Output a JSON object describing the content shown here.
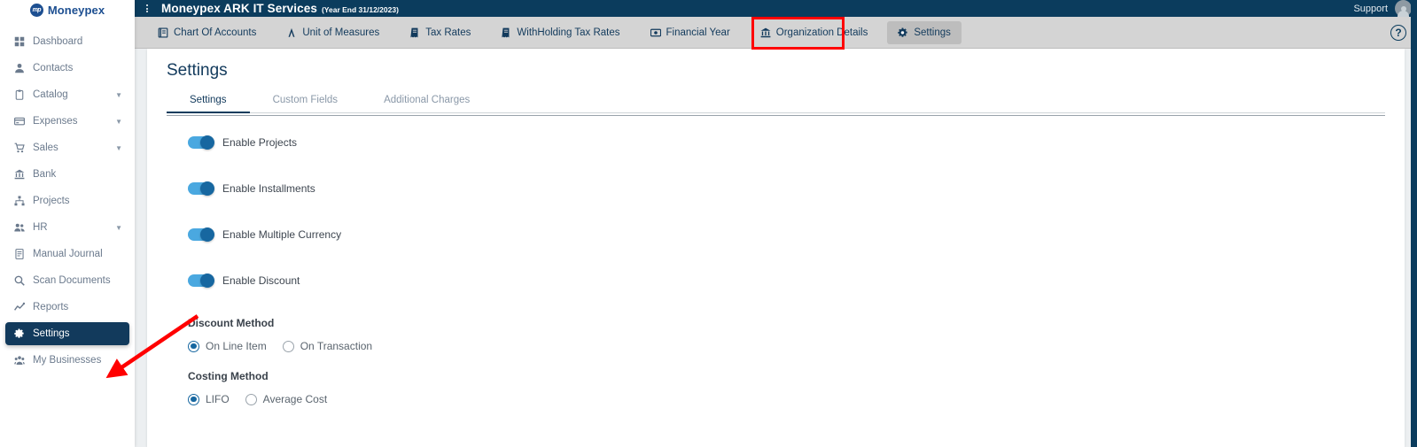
{
  "brand": {
    "name": "Moneypex",
    "logo_glyph": "mp",
    "accent_dark": "#0b3c5d",
    "accent_blue": "#1767a0",
    "toggle_track": "#4aa8e0",
    "annotation_red": "#ff0000"
  },
  "sidebar": {
    "items": [
      {
        "label": "Dashboard",
        "icon": "grid-icon",
        "caret": false,
        "active": false
      },
      {
        "label": "Contacts",
        "icon": "user-icon",
        "caret": false,
        "active": false
      },
      {
        "label": "Catalog",
        "icon": "clipboard-icon",
        "caret": true,
        "active": false
      },
      {
        "label": "Expenses",
        "icon": "card-icon",
        "caret": true,
        "active": false
      },
      {
        "label": "Sales",
        "icon": "cart-icon",
        "caret": true,
        "active": false
      },
      {
        "label": "Bank",
        "icon": "bank-icon",
        "caret": false,
        "active": false
      },
      {
        "label": "Projects",
        "icon": "sitemap-icon",
        "caret": false,
        "active": false
      },
      {
        "label": "HR",
        "icon": "users-icon",
        "caret": true,
        "active": false
      },
      {
        "label": "Manual Journal",
        "icon": "journal-icon",
        "caret": false,
        "active": false
      },
      {
        "label": "Scan Documents",
        "icon": "search-icon",
        "caret": false,
        "active": false
      },
      {
        "label": "Reports",
        "icon": "chart-line-icon",
        "caret": false,
        "active": false
      },
      {
        "label": "Settings",
        "icon": "gears-icon",
        "caret": false,
        "active": true
      },
      {
        "label": "My Businesses",
        "icon": "users-group-icon",
        "caret": false,
        "active": false
      }
    ]
  },
  "topbar": {
    "kebab_icon": "kebab-menu-icon",
    "title": "Moneypex ARK IT Services",
    "subtitle": "(Year End 31/12/2023)",
    "support_label": "Support",
    "avatar_icon": "user-avatar-icon"
  },
  "subnav": {
    "items": [
      {
        "label": "Chart Of Accounts",
        "icon": "book-icon",
        "active": false
      },
      {
        "label": "Unit of Measures",
        "icon": "compass-icon",
        "active": false
      },
      {
        "label": "Tax Rates",
        "icon": "receipt-icon",
        "active": false
      },
      {
        "label": "WithHolding Tax Rates",
        "icon": "receipt-icon",
        "active": false
      },
      {
        "label": "Financial Year",
        "icon": "money-bill-icon",
        "active": false
      },
      {
        "label": "Organization Details",
        "icon": "bank-icon",
        "active": false
      },
      {
        "label": "Settings",
        "icon": "gears-icon",
        "active": true
      }
    ],
    "help_glyph": "?",
    "help_icon": "help-circle-icon"
  },
  "main": {
    "page_title": "Settings",
    "tabs": [
      {
        "label": "Settings",
        "active": true
      },
      {
        "label": "Custom Fields",
        "active": false
      },
      {
        "label": "Additional Charges",
        "active": false
      }
    ],
    "toggles": [
      {
        "label": "Enable Projects",
        "on": true
      },
      {
        "label": "Enable Installments",
        "on": true
      },
      {
        "label": "Enable Multiple Currency",
        "on": true
      },
      {
        "label": "Enable Discount",
        "on": true
      }
    ],
    "discount_method": {
      "title": "Discount Method",
      "options": [
        {
          "label": "On Line Item",
          "selected": true
        },
        {
          "label": "On Transaction",
          "selected": false
        }
      ]
    },
    "costing_method": {
      "title": "Costing Method",
      "options": [
        {
          "label": "LIFO",
          "selected": true
        },
        {
          "label": "Average Cost",
          "selected": false
        }
      ]
    }
  },
  "annotations": {
    "highlight_rect_target": "subnav-settings-tab",
    "arrow_target": "sidebar-item-settings"
  }
}
